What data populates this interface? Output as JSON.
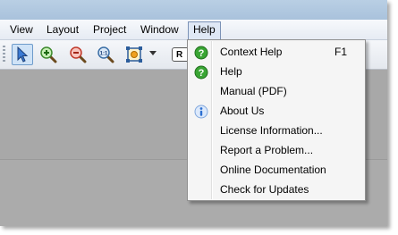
{
  "menubar": {
    "items": [
      {
        "label": "View"
      },
      {
        "label": "Layout"
      },
      {
        "label": "Project"
      },
      {
        "label": "Window"
      },
      {
        "label": "Help"
      }
    ]
  },
  "help_menu": {
    "items": [
      {
        "label": "Context Help",
        "shortcut": "F1",
        "icon": "help-question-icon"
      },
      {
        "label": "Help",
        "icon": "help-question-icon"
      },
      {
        "label": "Manual (PDF)"
      },
      {
        "label": "About Us",
        "icon": "info-icon"
      },
      {
        "label": "License Information..."
      },
      {
        "label": "Report a Problem..."
      },
      {
        "label": "Online Documentation"
      },
      {
        "label": "Check for Updates"
      }
    ]
  },
  "toolbar": {
    "field_label": "R"
  },
  "colors": {
    "menu_highlight": "#dfe8f5",
    "help_icon_green": "#3aa534",
    "info_icon_blue": "#2c6fd1"
  }
}
